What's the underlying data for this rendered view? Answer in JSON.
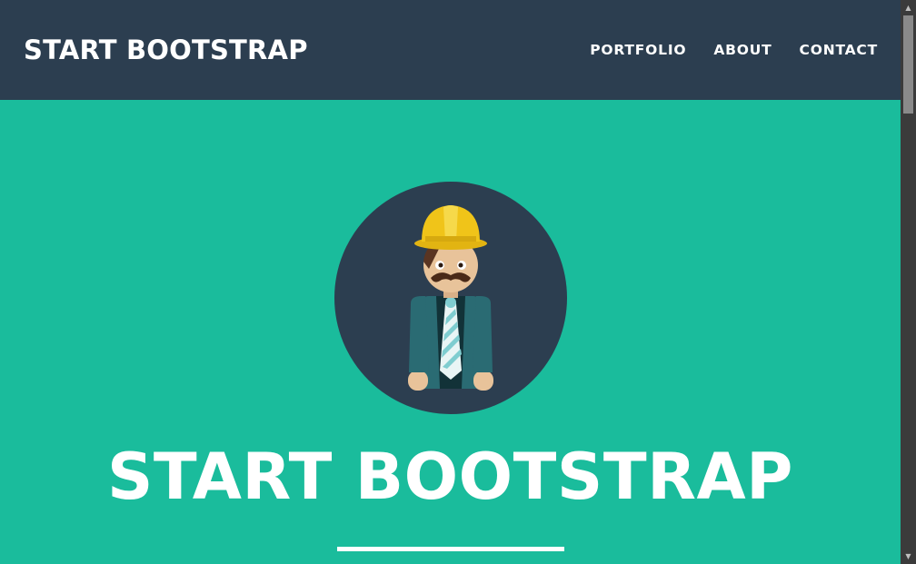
{
  "navbar": {
    "brand": "START BOOTSTRAP",
    "links": [
      "PORTFOLIO",
      "ABOUT",
      "CONTACT"
    ]
  },
  "masthead": {
    "title": "START BOOTSTRAP",
    "avatar_icon": "avatar-icon"
  },
  "colors": {
    "navbar_bg": "#2c3e50",
    "masthead_bg": "#1abc9c",
    "text": "#ffffff",
    "avatar_circle": "#2c3e50",
    "hat": "#f0c419"
  }
}
